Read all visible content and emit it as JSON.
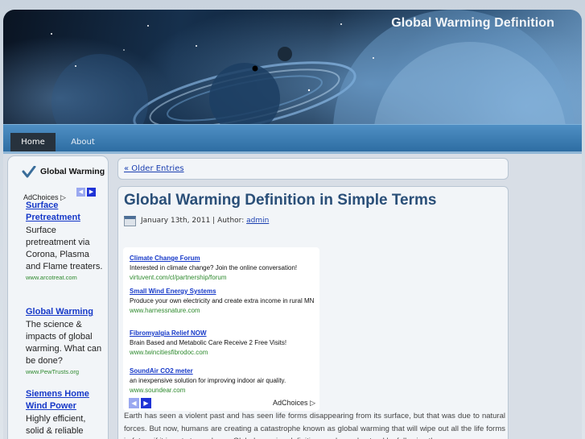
{
  "site": {
    "title": "Global Warming Definition"
  },
  "nav": {
    "items": [
      {
        "label": "Home"
      },
      {
        "label": "About"
      }
    ]
  },
  "sidebar": {
    "widget_title": "Global Warming",
    "adchoices": "AdChoices",
    "ads": [
      {
        "title": "Surface Pretreatment",
        "desc": "Surface pretreatment via Corona, Plasma and Flame treaters.",
        "url": "www.arcotreat.com"
      },
      {
        "title": "Global Warming",
        "desc": "The science & impacts of global warming. What can be done?",
        "url": "www.PewTrusts.org"
      },
      {
        "title": "Siemens Home Wind Power",
        "desc": "Highly efficient, solid & reliable",
        "url": ""
      }
    ]
  },
  "main": {
    "older_entries": "« Older Entries",
    "post": {
      "title": "Global Warming Definition in Simple Terms",
      "date": "January 13th, 2011",
      "author_label": "Author:",
      "author": "admin",
      "body": "Earth has seen a violent past and has seen life forms disappearing from its surface, but that was due to natural forces. But now, humans are creating a catastrophe known as global warming that will wipe out all the life forms in future if it is not stopped now. Global warming definition can be understood by following the"
    },
    "ads": [
      {
        "title": "Climate Change Forum",
        "desc": "Interested in climate change? Join the online conversation!",
        "url": "virtuvent.com/cl/partnership/forum"
      },
      {
        "title": "Small Wind Energy Systems",
        "desc": "Produce your own electricity and create extra income in rural MN",
        "url": "www.harnessnature.com"
      },
      {
        "title": "Fibromyalgia Relief NOW",
        "desc": "Brain Based and Metabolic Care Receive 2 Free Visits!",
        "url": "www.twincitiesfibrodoc.com"
      },
      {
        "title": "SoundAir CO2 meter",
        "desc": "an inexpensive solution for improving indoor air quality.",
        "url": "www.soundear.com"
      }
    ],
    "adchoices": "AdChoices"
  },
  "icons": {
    "check": "checkmark-icon",
    "calendar": "calendar-icon",
    "prev": "arrow-left-icon",
    "next": "arrow-right-icon",
    "adchoices": "adchoices-icon"
  },
  "colors": {
    "nav_bar": "#3d7fb5",
    "nav_active": "#27323d",
    "title_blue": "#2a4f78",
    "link_blue": "#1538c8",
    "ad_url_green": "#2e8a2e"
  }
}
